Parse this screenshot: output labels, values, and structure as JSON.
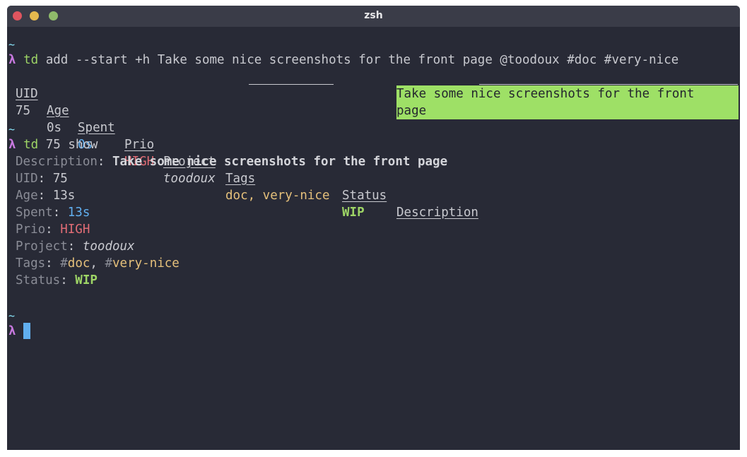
{
  "window": {
    "title": "zsh"
  },
  "prompt": {
    "tilde": "~",
    "lambda": "λ"
  },
  "command1": {
    "program": "td",
    "args": "add --start +h Take some nice screenshots for the front page @toodoux #doc #very-nice"
  },
  "table": {
    "headers": [
      "UID",
      "Age",
      "Spent",
      "Prio",
      "Project",
      "Tags",
      "Status",
      "Description"
    ],
    "row": {
      "uid": "75",
      "age": "0s",
      "spent": "0s",
      "prio": "HIGH",
      "project": "toodoux",
      "tags": "doc, very-nice",
      "status": "WIP",
      "description_line1": "Take some nice screenshots for the front",
      "description_line2": "page"
    }
  },
  "command2": {
    "program": "td",
    "args": "75 show"
  },
  "details": {
    "description_label": "Description",
    "description_value": "Take some nice screenshots for the front page",
    "uid_label": "UID",
    "uid_value": "75",
    "age_label": "Age",
    "age_value": "13s",
    "spent_label": "Spent",
    "spent_value": "13s",
    "prio_label": "Prio",
    "prio_value": "HIGH",
    "project_label": "Project",
    "project_value": "toodoux",
    "tags_label": "Tags",
    "tag1": "doc",
    "tag2": "very-nice",
    "status_label": "Status",
    "status_value": "WIP"
  },
  "colors": {
    "background": "#282a36",
    "titlebar": "#3a3c48",
    "lambda": "#c678dd",
    "command": "#9ed566",
    "highlight": "#9ee066",
    "high_priority": "#e06c75",
    "duration": "#61afef",
    "tags": "#e5c07b"
  }
}
